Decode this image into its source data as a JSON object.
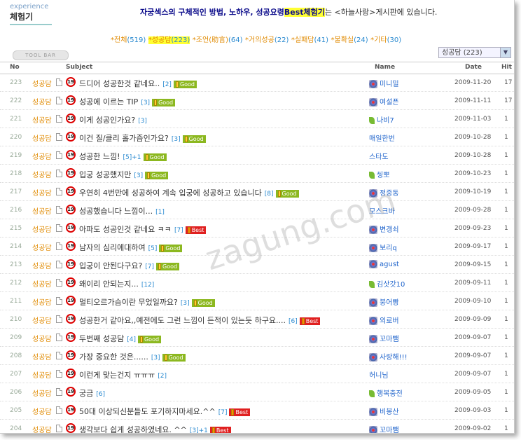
{
  "header": {
    "title_en": "experience",
    "title_ko": "체험기",
    "notice_pre": "자궁섹스의 구체적인 방법, 노하우, 성공요령",
    "notice_hl": "Best체험기",
    "notice_post": "는 <하늘사랑>게시판에 있습니다."
  },
  "categories": [
    {
      "label": "*전체",
      "count": "(519)",
      "selected": false
    },
    {
      "label": "*성공담",
      "count": "(223)",
      "selected": true
    },
    {
      "label": "*조언(助言)",
      "count": "(64)",
      "selected": false
    },
    {
      "label": "*거의성공",
      "count": "(22)",
      "selected": false
    },
    {
      "label": "*실패담",
      "count": "(41)",
      "selected": false
    },
    {
      "label": "*불확실",
      "count": "(24)",
      "selected": false
    },
    {
      "label": "*기타",
      "count": "(30)",
      "selected": false
    }
  ],
  "toolbar_label": "TOOL BAR",
  "filter_select": {
    "value": "성공담 (223)"
  },
  "columns": {
    "no": "No",
    "subject": "Subject",
    "name": "Name",
    "date": "Date",
    "hit": "Hit"
  },
  "watermark": "zagung.com",
  "rows": [
    {
      "no": "223",
      "cat": "성공담",
      "subject": "드디어 성공한것 같네요..",
      "comments": "[2]",
      "tag": "Good",
      "name": "미니밀",
      "icon": "flower",
      "date": "2009-11-20",
      "hit": "17"
    },
    {
      "no": "222",
      "cat": "성공담",
      "subject": "성공에 이르는 TIP",
      "comments": "[3]",
      "tag": "Good",
      "name": "여설픈",
      "icon": "flower",
      "date": "2009-11-11",
      "hit": "17"
    },
    {
      "no": "221",
      "cat": "성공담",
      "subject": "이게 성공인가요?",
      "comments": "[3]",
      "tag": "",
      "name": "나비7",
      "icon": "leaf",
      "date": "2009-11-03",
      "hit": "1"
    },
    {
      "no": "220",
      "cat": "성공담",
      "subject": "이건 질/클리 홀가즘인가요?",
      "comments": "[3]",
      "tag": "Good",
      "name": "매일한번",
      "icon": "",
      "date": "2009-10-28",
      "hit": "1"
    },
    {
      "no": "219",
      "cat": "성공담",
      "subject": "성공한 느낌!",
      "comments": "[5]+1",
      "tag": "Good",
      "name": "스타도",
      "icon": "",
      "date": "2009-10-28",
      "hit": "1"
    },
    {
      "no": "218",
      "cat": "성공담",
      "subject": "입궁 성공했지만",
      "comments": "[3]",
      "tag": "Good",
      "name": "씽뽀",
      "icon": "leaf",
      "date": "2009-10-23",
      "hit": "1"
    },
    {
      "no": "217",
      "cat": "성공담",
      "subject": "우연히 4번만에 성공하여 계속 입궁에 성공하고 있습니다",
      "comments": "[8]",
      "tag": "Good",
      "name": "정중동",
      "icon": "flower",
      "date": "2009-10-19",
      "hit": "1"
    },
    {
      "no": "216",
      "cat": "성공담",
      "subject": "성공했습니다 느낌이...",
      "comments": "[1]",
      "tag": "",
      "name": "모스크바",
      "icon": "",
      "date": "2009-09-28",
      "hit": "1"
    },
    {
      "no": "215",
      "cat": "성공담",
      "subject": "아파도 성공인것 같네요 ㅋㅋ",
      "comments": "[7]",
      "tag": "Best",
      "name": "변갱쇠",
      "icon": "flower",
      "date": "2009-09-23",
      "hit": "1"
    },
    {
      "no": "214",
      "cat": "성공담",
      "subject": "남자의 심리에대하여",
      "comments": "[5]",
      "tag": "Good",
      "name": "보리q",
      "icon": "flower",
      "date": "2009-09-17",
      "hit": "1"
    },
    {
      "no": "213",
      "cat": "성공담",
      "subject": "입궁이 안된다구요?",
      "comments": "[7]",
      "tag": "Good",
      "name": "agust",
      "icon": "flower",
      "date": "2009-09-15",
      "hit": "1"
    },
    {
      "no": "212",
      "cat": "성공담",
      "subject": "왜이리 안되는지...",
      "comments": "[12]",
      "tag": "",
      "name": "김삿갓10",
      "icon": "leaf",
      "date": "2009-09-11",
      "hit": "1"
    },
    {
      "no": "211",
      "cat": "성공담",
      "subject": "멀티오르가슴이란 무었일까요?",
      "comments": "[3]",
      "tag": "Good",
      "name": "붕어빵",
      "icon": "flower",
      "date": "2009-09-10",
      "hit": "1"
    },
    {
      "no": "210",
      "cat": "성공담",
      "subject": "성공한거 같아요,,예전에도 그런 느낌이 든적이 있는듯 하구요....",
      "comments": "[6]",
      "tag": "Best",
      "name": "외로버",
      "icon": "flower",
      "date": "2009-09-09",
      "hit": "1"
    },
    {
      "no": "209",
      "cat": "성공담",
      "subject": "두번째 성공담",
      "comments": "[4]",
      "tag": "Good",
      "name": "꼬마뺌",
      "icon": "flower",
      "date": "2009-09-07",
      "hit": "1"
    },
    {
      "no": "208",
      "cat": "성공담",
      "subject": "가장 중요한 것은......",
      "comments": "[3]",
      "tag": "Good",
      "name": "사랑해!!!",
      "icon": "flower",
      "date": "2009-09-07",
      "hit": "1"
    },
    {
      "no": "207",
      "cat": "성공담",
      "subject": "이런게 맞는건지 ㅠㅠㅠ",
      "comments": "[2]",
      "tag": "",
      "name": "허니님",
      "icon": "",
      "date": "2009-09-07",
      "hit": "1"
    },
    {
      "no": "206",
      "cat": "성공담",
      "subject": "궁금",
      "comments": "[6]",
      "tag": "",
      "name": "행복충전",
      "icon": "leaf",
      "date": "2009-09-05",
      "hit": "1"
    },
    {
      "no": "205",
      "cat": "성공담",
      "subject": "50대 이상되신분들도 포기하지마세요.^^",
      "comments": "[7]",
      "tag": "Best",
      "name": "비봉산",
      "icon": "flower",
      "date": "2009-09-03",
      "hit": "1"
    },
    {
      "no": "204",
      "cat": "성공담",
      "subject": "생각보다 쉽게 성공하였네요. ^^",
      "comments": "[3]+1",
      "tag": "Best",
      "name": "꼬마뺌",
      "icon": "flower",
      "date": "2009-09-02",
      "hit": "1"
    }
  ]
}
